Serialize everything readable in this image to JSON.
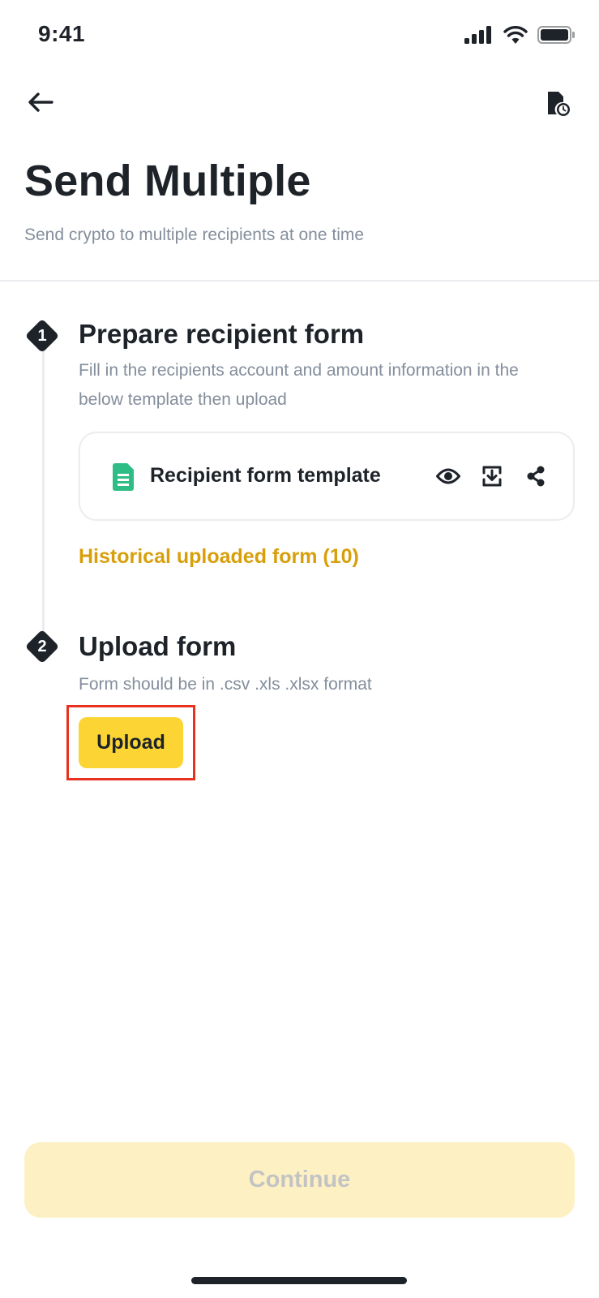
{
  "status_bar": {
    "time": "9:41",
    "icons": [
      "cellular-signal-icon",
      "wifi-icon",
      "battery-icon"
    ]
  },
  "nav": {
    "back_icon": "back-arrow-icon",
    "history_icon": "document-history-icon"
  },
  "header": {
    "title": "Send Multiple",
    "subtitle": "Send crypto to multiple recipients at one time"
  },
  "steps": [
    {
      "number": "1",
      "title": "Prepare recipient form",
      "description": "Fill in the recipients account and amount information in the below template then upload"
    },
    {
      "number": "2",
      "title": "Upload form",
      "description": "Form should be in .csv .xls .xlsx format"
    }
  ],
  "template_card": {
    "label": "Recipient form template",
    "icon": "spreadsheet-icon",
    "actions": [
      "view-icon",
      "download-icon",
      "share-icon"
    ]
  },
  "history_link": "Historical uploaded form (10)",
  "upload_button": "Upload",
  "continue_button": "Continue",
  "colors": {
    "primary_yellow": "#fcd535",
    "link_gold": "#d89f0b",
    "disabled_yellow": "#fdf1c3",
    "text_primary": "#1e2329",
    "text_secondary": "#848e9c",
    "highlight_red": "#e9311f",
    "sheet_green": "#2ebd85"
  }
}
